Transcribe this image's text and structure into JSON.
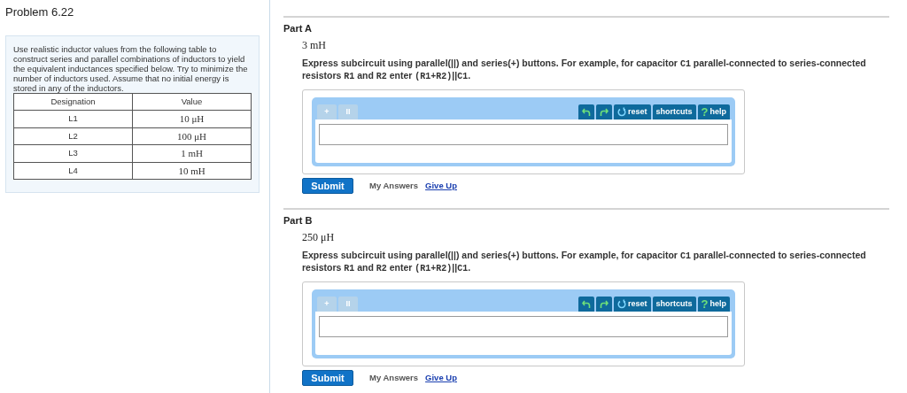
{
  "problem": {
    "title": "Problem 6.22",
    "intro": "Use realistic inductor values from the following table to construct series and parallel combinations of inductors to yield the equivalent inductances specified below. Try to minimize the number of inductors used. Assume that no initial energy is stored in any of the inductors.",
    "table": {
      "columns": [
        "Designation",
        "Value"
      ],
      "rows": [
        [
          "L1",
          "10 μH"
        ],
        [
          "L2",
          "100 μH"
        ],
        [
          "L3",
          "1 mH"
        ],
        [
          "L4",
          "10 mH"
        ]
      ]
    }
  },
  "parts": [
    {
      "title": "Part A",
      "target": "3 mH",
      "instruction": [
        {
          "kind": "text",
          "text": "Express subcircuit using parallel(||) and series(+) buttons. For example, for capacitor "
        },
        {
          "kind": "code",
          "text": "C1"
        },
        {
          "kind": "text",
          "text": " parallel-connected to series-connected resistors "
        },
        {
          "kind": "code",
          "text": "R1"
        },
        {
          "kind": "text",
          "text": " and "
        },
        {
          "kind": "code",
          "text": "R2"
        },
        {
          "kind": "text",
          "text": " enter "
        },
        {
          "kind": "code",
          "text": "(R1+R2)"
        },
        {
          "kind": "text",
          "text": "||"
        },
        {
          "kind": "code",
          "text": "C1"
        },
        {
          "kind": "text",
          "text": "."
        }
      ],
      "toolbar": [
        {
          "kind": "symbol",
          "label": "+",
          "disabled": true
        },
        {
          "kind": "symbol",
          "label": "II",
          "disabled": true
        },
        {
          "kind": "undo"
        },
        {
          "kind": "redo"
        },
        {
          "kind": "reset",
          "label": "reset"
        },
        {
          "kind": "text",
          "label": "shortcuts"
        },
        {
          "kind": "help",
          "glyph": "?",
          "label": "help"
        }
      ],
      "submit": "Submit",
      "my_answers": "My Answers",
      "give_up": "Give Up"
    },
    {
      "title": "Part B",
      "target": "250 μH",
      "instruction": [
        {
          "kind": "text",
          "text": "Express subcircuit using parallel(||) and series(+) buttons. For example, for capacitor "
        },
        {
          "kind": "code",
          "text": "C1"
        },
        {
          "kind": "text",
          "text": " parallel-connected to series-connected resistors "
        },
        {
          "kind": "code",
          "text": "R1"
        },
        {
          "kind": "text",
          "text": " and "
        },
        {
          "kind": "code",
          "text": "R2"
        },
        {
          "kind": "text",
          "text": " enter "
        },
        {
          "kind": "code",
          "text": "(R1+R2)"
        },
        {
          "kind": "text",
          "text": "||"
        },
        {
          "kind": "code",
          "text": "C1"
        },
        {
          "kind": "text",
          "text": "."
        }
      ],
      "toolbar": [
        {
          "kind": "symbol",
          "label": "+",
          "disabled": true
        },
        {
          "kind": "symbol",
          "label": "II",
          "disabled": true
        },
        {
          "kind": "undo"
        },
        {
          "kind": "redo"
        },
        {
          "kind": "reset",
          "label": "reset"
        },
        {
          "kind": "text",
          "label": "shortcuts"
        },
        {
          "kind": "help",
          "glyph": "?",
          "label": "help"
        }
      ],
      "submit": "Submit",
      "my_answers": "My Answers",
      "give_up": "Give Up"
    }
  ]
}
